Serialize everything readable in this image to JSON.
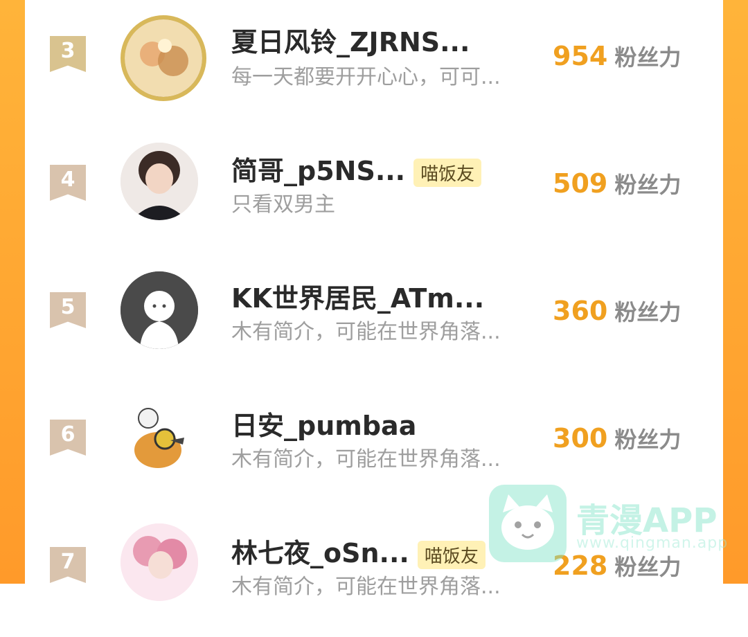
{
  "ranking": [
    {
      "rank": "3",
      "name": "夏日风铃_ZJRNS...",
      "tag": "",
      "bio": "每一天都要开开心心，可可...",
      "score": "954",
      "unit": "粉丝力"
    },
    {
      "rank": "4",
      "name": "简哥_p5NS...",
      "tag": "喵饭友",
      "bio": "只看双男主",
      "score": "509",
      "unit": "粉丝力"
    },
    {
      "rank": "5",
      "name": "KK世界居民_ATm...",
      "tag": "",
      "bio": "木有简介，可能在世界角落...",
      "score": "360",
      "unit": "粉丝力"
    },
    {
      "rank": "6",
      "name": "日安_pumbaa",
      "tag": "",
      "bio": "木有简介，可能在世界角落...",
      "score": "300",
      "unit": "粉丝力"
    },
    {
      "rank": "7",
      "name": "林七夜_oSn...",
      "tag": "喵饭友",
      "bio": "木有简介，可能在世界角落...",
      "score": "228",
      "unit": "粉丝力"
    }
  ],
  "watermark": {
    "title": "青漫APP",
    "url": "www.qingman.app"
  },
  "colors": {
    "accent": "#f0a020",
    "side": "#ffa630",
    "tag_bg": "#fff1b6",
    "rank_badge": "#d9c3ad"
  }
}
